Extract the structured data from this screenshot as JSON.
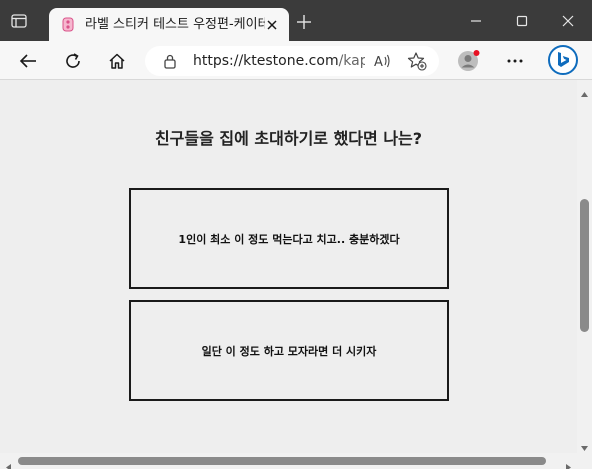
{
  "browser": {
    "tab": {
      "title": "라벨 스티커 테스트 우정편-케이테",
      "favicon": "label-sticker-favicon"
    },
    "address": {
      "url_host": "https://ktestone.com",
      "url_rest": "/kap..."
    },
    "icons": {
      "tab_actions": "tab-actions-icon",
      "close_tab": "close-icon",
      "new_tab": "plus-icon",
      "back": "back-arrow-icon",
      "refresh": "refresh-icon",
      "home": "home-icon",
      "lock": "lock-icon",
      "read_aloud": "read-aloud-icon",
      "add_favorite": "favorite-add-icon",
      "profile": "profile-icon",
      "more": "more-icon",
      "copilot": "bing-icon"
    },
    "accent_color": "#0f6cbd",
    "notification_dot_color": "#e81123"
  },
  "quiz": {
    "question": "친구들을 집에 초대하기로 했다면 나는?",
    "answers": [
      {
        "label": "1인이 최소 이 정도 먹는다고 치고.. 충분하겠다"
      },
      {
        "label": "일단 이 정도 하고 모자라면 더 시키자"
      }
    ]
  }
}
